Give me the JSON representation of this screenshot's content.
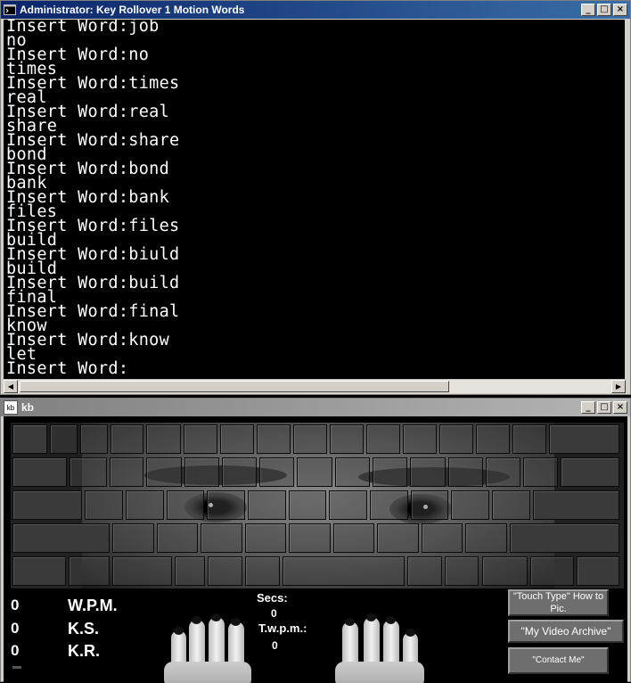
{
  "console_window": {
    "title": "Administrator: Key Rollover 1 Motion Words",
    "minimize": "_",
    "maximize": "□",
    "close": "×",
    "lines": [
      "Insert Word:job",
      "no",
      "Insert Word:no",
      "times",
      "Insert Word:times",
      "real",
      "Insert Word:real",
      "share",
      "Insert Word:share",
      "bond",
      "Insert Word:bond",
      "bank",
      "Insert Word:bank",
      "files",
      "Insert Word:files",
      "build",
      "Insert Word:biuld",
      "build",
      "Insert Word:build",
      "final",
      "Insert Word:final",
      "know",
      "Insert Word:know",
      "let",
      "Insert Word:"
    ]
  },
  "kb_window": {
    "icon_text": "kb",
    "title": "kb",
    "minimize": "_",
    "maximize": "□",
    "close": "×",
    "stats": [
      {
        "value": "0",
        "label": "W.P.M."
      },
      {
        "value": "0",
        "label": "K.S."
      },
      {
        "value": "0",
        "label": "K.R."
      }
    ],
    "secs_label": "Secs:",
    "secs_value": "0",
    "twpm_label": "T.w.p.m.:",
    "twpm_value": "0",
    "buttons": {
      "touch_type": "\"Touch Type\" How to Pic.",
      "video_archive": "\"My Video Archive\"",
      "contact": "\"Contact Me\""
    }
  }
}
